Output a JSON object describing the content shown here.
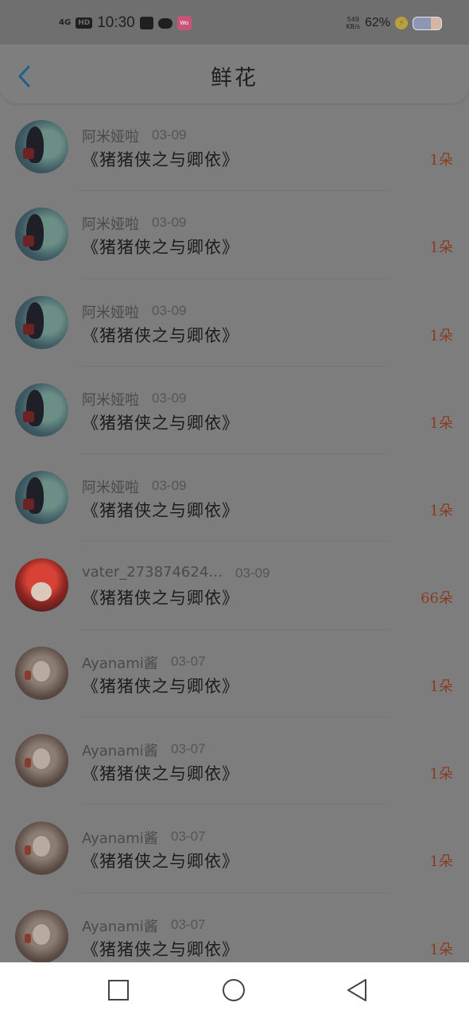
{
  "status_bar": {
    "signal": "4G",
    "hd": "HD",
    "time": "10:30",
    "app_badge": "Wo",
    "speed_top": "549",
    "speed_bottom": "KB/s",
    "battery_percent": "62%",
    "battery_level": 0.62
  },
  "header": {
    "title": "鲜花"
  },
  "items": [
    {
      "user": "阿米娅啦",
      "date": "03-09",
      "book": "《猪猪侠之与卿依》",
      "count": "1朵",
      "avatar": "a1"
    },
    {
      "user": "阿米娅啦",
      "date": "03-09",
      "book": "《猪猪侠之与卿依》",
      "count": "1朵",
      "avatar": "a1"
    },
    {
      "user": "阿米娅啦",
      "date": "03-09",
      "book": "《猪猪侠之与卿依》",
      "count": "1朵",
      "avatar": "a1"
    },
    {
      "user": "阿米娅啦",
      "date": "03-09",
      "book": "《猪猪侠之与卿依》",
      "count": "1朵",
      "avatar": "a1"
    },
    {
      "user": "阿米娅啦",
      "date": "03-09",
      "book": "《猪猪侠之与卿依》",
      "count": "1朵",
      "avatar": "a1"
    },
    {
      "user": "vater_273874624…",
      "date": "03-09",
      "book": "《猪猪侠之与卿依》",
      "count": "66朵",
      "avatar": "a2"
    },
    {
      "user": "Ayanami酱",
      "date": "03-07",
      "book": "《猪猪侠之与卿依》",
      "count": "1朵",
      "avatar": "a3"
    },
    {
      "user": "Ayanami酱",
      "date": "03-07",
      "book": "《猪猪侠之与卿依》",
      "count": "1朵",
      "avatar": "a3"
    },
    {
      "user": "Ayanami酱",
      "date": "03-07",
      "book": "《猪猪侠之与卿依》",
      "count": "1朵",
      "avatar": "a3"
    },
    {
      "user": "Ayanami酱",
      "date": "03-07",
      "book": "《猪猪侠之与卿依》",
      "count": "1朵",
      "avatar": "a3"
    }
  ],
  "nav": {
    "icons": [
      "recents-square-icon",
      "home-circle-icon",
      "back-triangle-icon"
    ]
  },
  "colors": {
    "back_arrow": "#1f5f8e",
    "count_text": "#8a3b1d"
  }
}
